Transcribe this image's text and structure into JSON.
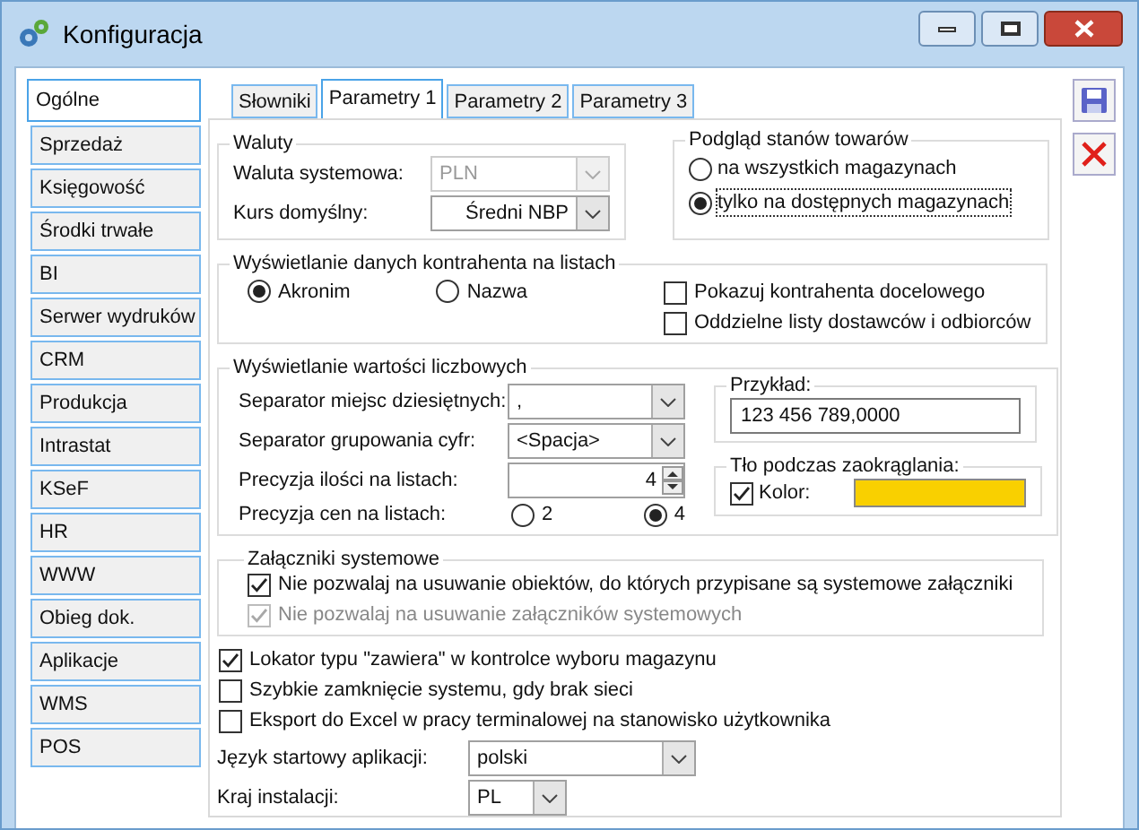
{
  "window": {
    "title": "Konfiguracja"
  },
  "sidebar": {
    "items": [
      {
        "label": "Ogólne",
        "selected": true
      },
      {
        "label": "Sprzedaż",
        "selected": false
      },
      {
        "label": "Księgowość",
        "selected": false
      },
      {
        "label": "Środki trwałe",
        "selected": false
      },
      {
        "label": "BI",
        "selected": false
      },
      {
        "label": "Serwer wydruków",
        "selected": false
      },
      {
        "label": "CRM",
        "selected": false
      },
      {
        "label": "Produkcja",
        "selected": false
      },
      {
        "label": "Intrastat",
        "selected": false
      },
      {
        "label": "KSeF",
        "selected": false
      },
      {
        "label": "HR",
        "selected": false
      },
      {
        "label": "WWW",
        "selected": false
      },
      {
        "label": "Obieg dok.",
        "selected": false
      },
      {
        "label": "Aplikacje",
        "selected": false
      },
      {
        "label": "WMS",
        "selected": false
      },
      {
        "label": "POS",
        "selected": false
      }
    ]
  },
  "tabs": [
    {
      "label": "Słowniki",
      "selected": false
    },
    {
      "label": "Parametry 1",
      "selected": true
    },
    {
      "label": "Parametry 2",
      "selected": false
    },
    {
      "label": "Parametry 3",
      "selected": false
    }
  ],
  "waluty": {
    "title": "Waluty",
    "fields": [
      {
        "label": "Waluta systemowa:",
        "value": "PLN",
        "disabled": true
      },
      {
        "label": "Kurs domyślny:",
        "value": "Średni NBP",
        "disabled": false
      }
    ]
  },
  "podglad": {
    "title": "Podgląd stanów towarów",
    "options": [
      {
        "label": "na wszystkich magazynach",
        "selected": false
      },
      {
        "label": "tylko na dostępnych magazynach",
        "selected": true
      }
    ]
  },
  "kontrahent": {
    "title": "Wyświetlanie danych kontrahenta na listach",
    "options": [
      {
        "label": "Akronim",
        "selected": true
      },
      {
        "label": "Nazwa",
        "selected": false
      }
    ],
    "checkboxes": [
      {
        "label": "Pokazuj kontrahenta docelowego",
        "checked": false
      },
      {
        "label": "Oddzielne listy dostawców i odbiorców",
        "checked": false
      }
    ]
  },
  "liczbowe": {
    "title": "Wyświetlanie wartości liczbowych",
    "rows": [
      {
        "kind": "combo",
        "label": "Separator miejsc dziesiętnych:",
        "value": ","
      },
      {
        "kind": "combo",
        "label": "Separator grupowania cyfr:",
        "value": "<Spacja>"
      },
      {
        "kind": "spin",
        "label": "Precyzja ilości na listach:",
        "value": "4"
      },
      {
        "kind": "radio",
        "label": "Precyzja cen na listach:",
        "options": [
          {
            "label": "2",
            "selected": false
          },
          {
            "label": "4",
            "selected": true
          }
        ]
      }
    ],
    "przyklad": {
      "title": "Przykład:",
      "value": "123 456 789,0000"
    },
    "tlo": {
      "title": "Tło podczas zaokrąglania:",
      "label": "Kolor:",
      "checked": true,
      "color": "#f9d000"
    }
  },
  "zalaczniki": {
    "title": "Załączniki systemowe",
    "checkboxes": [
      {
        "label": "Nie pozwalaj na usuwanie obiektów, do których przypisane są systemowe załączniki",
        "checked": true,
        "disabled": false
      },
      {
        "label": "Nie pozwalaj na usuwanie załączników systemowych",
        "checked": true,
        "disabled": true
      }
    ]
  },
  "checkboxes": [
    {
      "label": "Lokator typu \"zawiera\" w kontrolce wyboru magazynu",
      "checked": true
    },
    {
      "label": "Szybkie zamknięcie systemu, gdy brak sieci",
      "checked": false
    },
    {
      "label": "Eksport do Excel w pracy terminalowej na stanowisko użytkownika",
      "checked": false
    }
  ],
  "startup": [
    {
      "label": "Język startowy aplikacji:",
      "value": "polski",
      "wide": true
    },
    {
      "label": "Kraj instalacji:",
      "value": "PL",
      "wide": false
    }
  ]
}
